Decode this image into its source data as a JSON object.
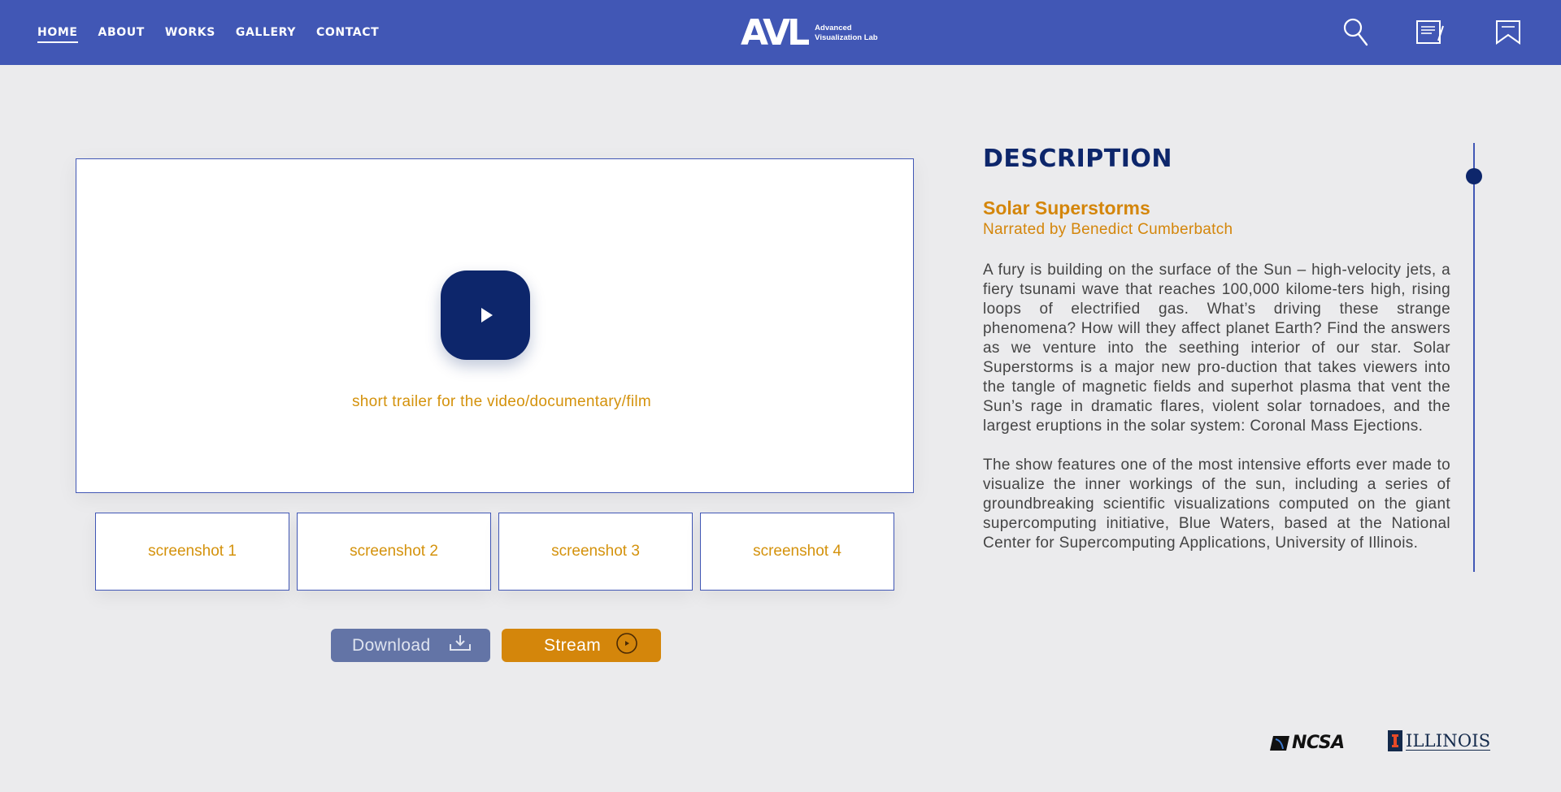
{
  "nav": {
    "items": [
      {
        "label": "HOME",
        "active": true
      },
      {
        "label": "ABOUT",
        "active": false
      },
      {
        "label": "WORKS",
        "active": false
      },
      {
        "label": "GALLERY",
        "active": false
      },
      {
        "label": "CONTACT",
        "active": false
      }
    ]
  },
  "logo": {
    "mark": "AVL",
    "line1": "Advanced",
    "line2": "Visualization Lab"
  },
  "header_icons": [
    "search-icon",
    "notes-icon",
    "bookmark-icon"
  ],
  "video": {
    "caption": "short trailer for the video/documentary/film"
  },
  "screenshots": [
    "screenshot 1",
    "screenshot 2",
    "screenshot 3",
    "screenshot 4"
  ],
  "actions": {
    "download_label": "Download",
    "stream_label": "Stream"
  },
  "description": {
    "heading": "DESCRIPTION",
    "title": "Solar Superstorms",
    "subtitle": "Narrated by Benedict Cumberbatch",
    "paragraph1": "A fury is building on the surface of the Sun – high-velocity jets, a fiery tsunami wave that reaches 100,000 kilome-ters high, rising loops of electrified gas. What’s driving these strange phenomena? How will they affect planet Earth? Find the answers as we venture into the seething interior of our star. Solar Superstorms is a major new pro-duction that takes viewers into the tangle of magnetic fields and superhot plasma that vent the Sun’s rage in dramatic flares, violent solar tornadoes, and the largest eruptions in the solar system: Coronal Mass Ejections.",
    "paragraph2": "The show features one of the most intensive efforts ever made to visualize the inner workings of the sun, including a series of groundbreaking scientific visualizations computed on the giant supercomputing initiative, Blue Waters, based at the National Center for Supercomputing Applications, University of Illinois."
  },
  "footer": {
    "ncsa": "NCSA",
    "illinois": "ILLINOIS"
  },
  "colors": {
    "header": "#4157b5",
    "navy": "#0d266b",
    "accent": "#d4860b",
    "download": "#6374a6",
    "background": "#ebebed"
  }
}
